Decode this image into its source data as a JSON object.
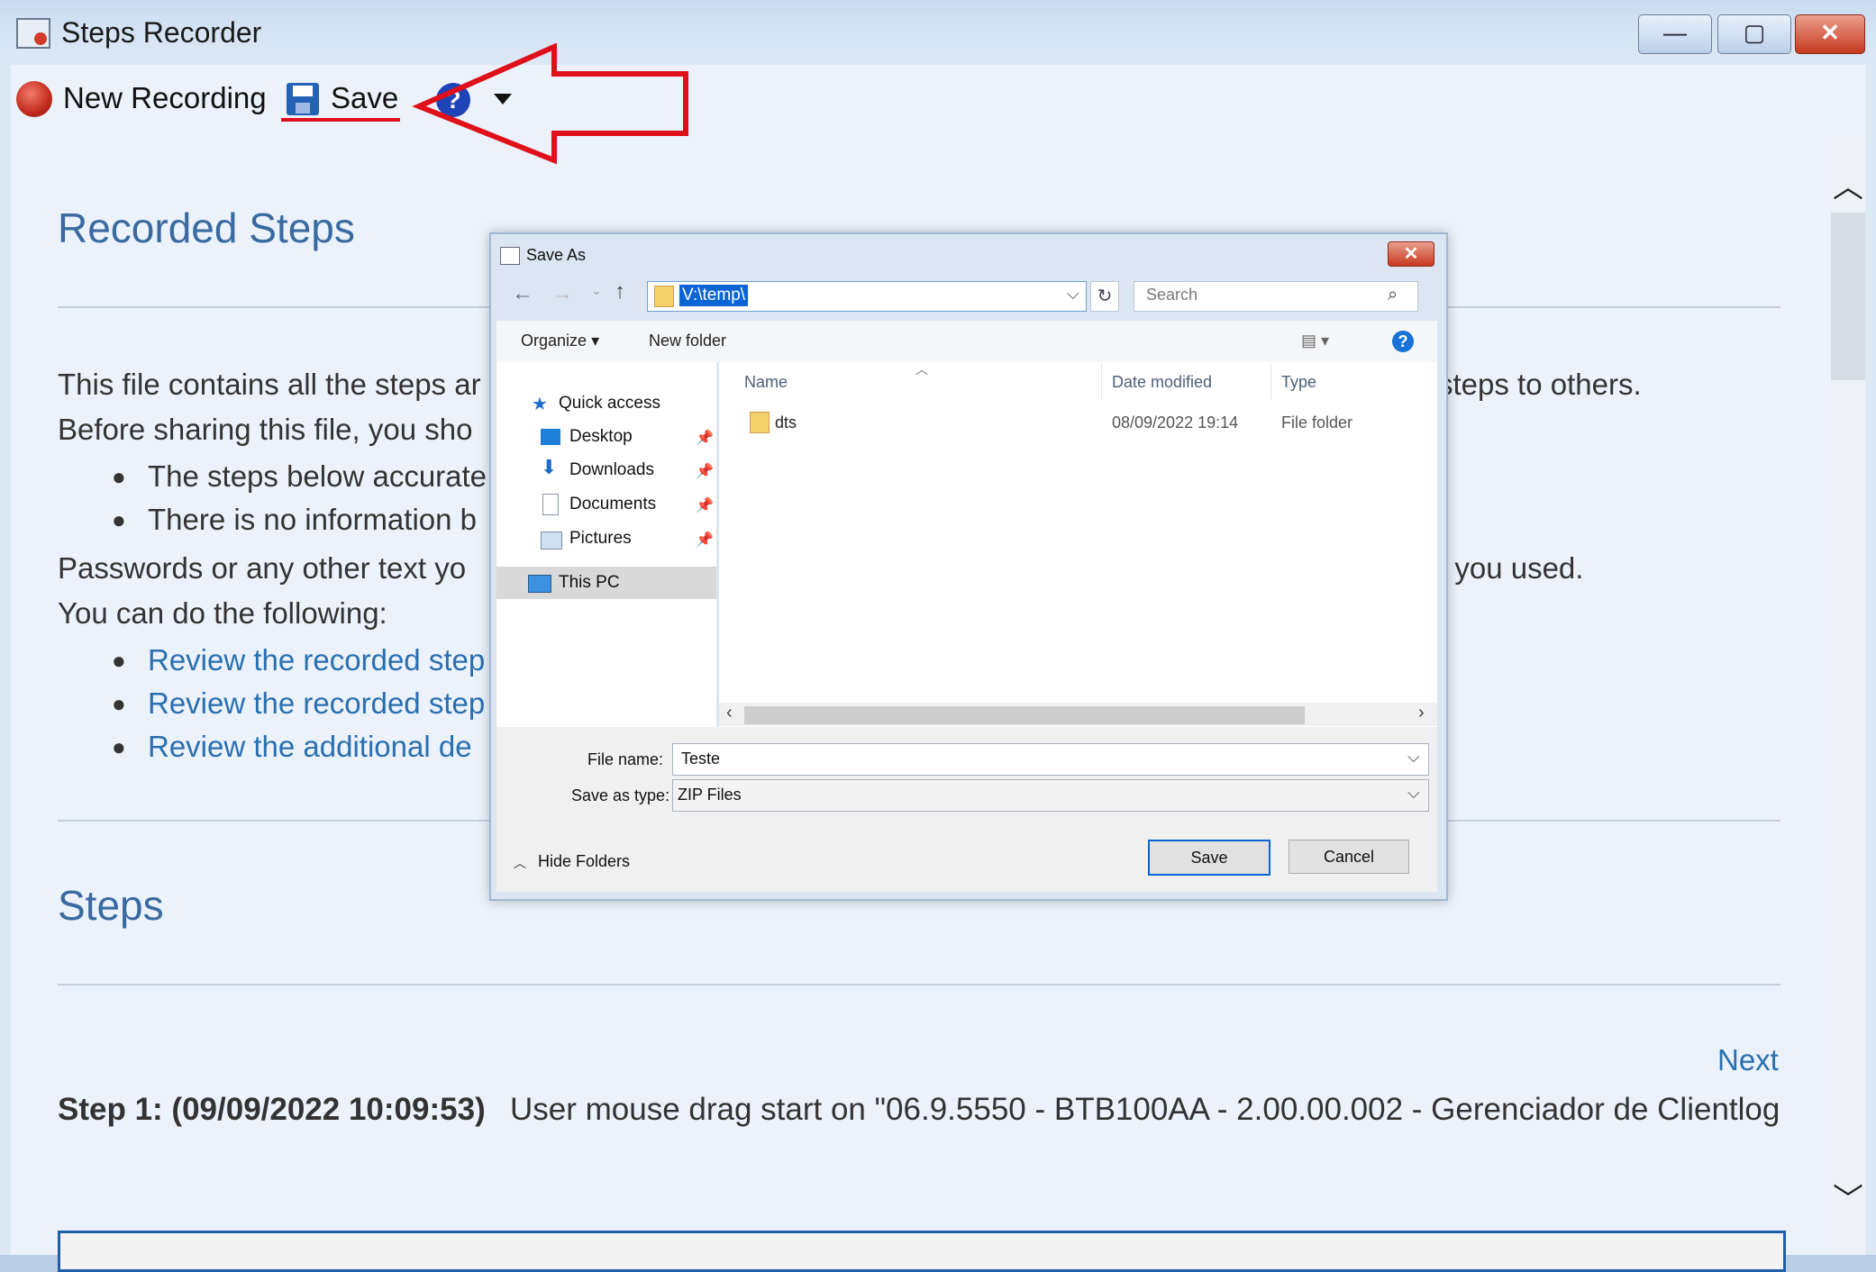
{
  "app": {
    "title": "Steps Recorder"
  },
  "window_controls": {
    "minimize": "—",
    "maximize": "▢",
    "close": "✕"
  },
  "toolbar": {
    "new_recording": "New Recording",
    "save": "Save",
    "help": "?"
  },
  "content": {
    "recorded_steps_heading": "Recorded Steps",
    "intro_line1_left": "This file contains all the steps ar",
    "intro_line1_right": "steps to others.",
    "intro_line2": "Before sharing this file, you sho",
    "bullets1": [
      "The steps below accurate",
      "There is no information b"
    ],
    "passwords_left": "Passwords or any other text yo",
    "passwords_right": "t you used.",
    "you_can": "You can do the following:",
    "links": [
      "Review the recorded step",
      "Review the recorded step",
      "Review the additional de"
    ],
    "steps_heading": "Steps",
    "next_link": "Next",
    "step1_bold": "Step 1: (09/09/2022 10:09:53)",
    "step1_text": "User mouse drag start on \"06.9.5550 - BTB100AA - 2.00.00.002 - Gerenciador de Clientlog"
  },
  "dialog": {
    "title": "Save As",
    "address": "V:\\temp\\",
    "search_placeholder": "Search",
    "organize": "Organize",
    "new_folder": "New folder",
    "nav": {
      "quick_access": "Quick access",
      "desktop": "Desktop",
      "downloads": "Downloads",
      "documents": "Documents",
      "pictures": "Pictures",
      "this_pc": "This PC"
    },
    "columns": {
      "name": "Name",
      "date": "Date modified",
      "type": "Type"
    },
    "files": [
      {
        "name": "dts",
        "date": "08/09/2022 19:14",
        "type": "File folder"
      }
    ],
    "file_name_label": "File name:",
    "file_name_value": "Teste",
    "save_type_label": "Save as type:",
    "save_type_value": "ZIP Files",
    "hide_folders": "Hide Folders",
    "save_button": "Save",
    "cancel_button": "Cancel"
  },
  "annotation": {
    "arrow_color": "#e0101a"
  }
}
